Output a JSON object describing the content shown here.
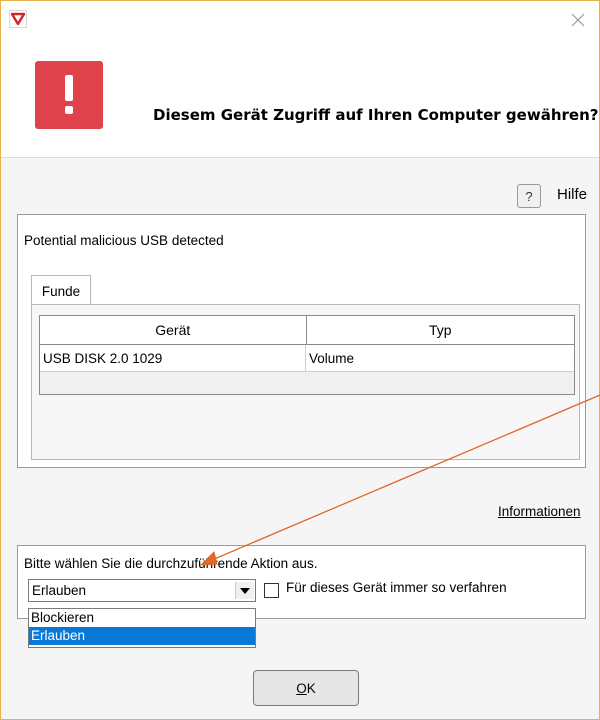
{
  "dialog": {
    "title": "Diesem Gerät Zugriff auf Ihren Computer gewähren?",
    "help": {
      "icon_text": "?",
      "label": "Hilfe"
    },
    "alert_icon_text": "!"
  },
  "detection": {
    "message": "Potential malicious USB detected",
    "tab_label": "Funde",
    "columns": [
      "Gerät",
      "Typ"
    ],
    "rows": [
      {
        "device": "USB DISK 2.0 1029",
        "type": "Volume"
      }
    ]
  },
  "info_link": "Informationen",
  "action": {
    "prompt": "Bitte wählen Sie die durchzuführende Aktion aus.",
    "selected": "Erlauben",
    "options": [
      "Blockieren",
      "Erlauben"
    ],
    "remember_label": "Für dieses Gerät immer so verfahren",
    "remember_checked": false
  },
  "ok_button": {
    "mnemonic": "O",
    "rest": "K"
  },
  "colors": {
    "alert": "#e0424b",
    "selection": "#0a78d7",
    "annotation_arrow": "#e0682a",
    "window_border": "#e8b04a"
  }
}
